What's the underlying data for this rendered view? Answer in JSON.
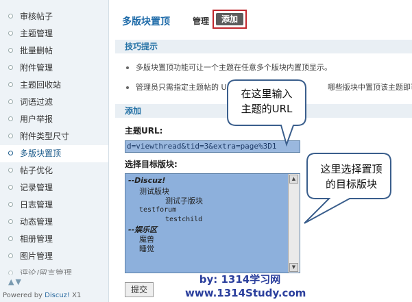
{
  "sidebar": {
    "items": [
      {
        "label": "审核帖子",
        "active": false
      },
      {
        "label": "主题管理",
        "active": false
      },
      {
        "label": "批量删帖",
        "active": false
      },
      {
        "label": "附件管理",
        "active": false
      },
      {
        "label": "主题回收站",
        "active": false
      },
      {
        "label": "词语过滤",
        "active": false
      },
      {
        "label": "用户举报",
        "active": false
      },
      {
        "label": "附件类型尺寸",
        "active": false
      },
      {
        "label": "多版块置顶",
        "active": true
      },
      {
        "label": "帖子优化",
        "active": false
      },
      {
        "label": "记录管理",
        "active": false
      },
      {
        "label": "日志管理",
        "active": false
      },
      {
        "label": "动态管理",
        "active": false
      },
      {
        "label": "相册管理",
        "active": false
      },
      {
        "label": "图片管理",
        "active": false
      },
      {
        "label": "评论/留言管理",
        "active": false
      }
    ],
    "powered_prefix": "Powered by ",
    "powered_brand": "Discuz!",
    "powered_version": " X1"
  },
  "header": {
    "title": "多版块置顶",
    "tab_manage": "管理",
    "tab_add": "添加"
  },
  "tips": {
    "heading": "技巧提示",
    "items": [
      "多版块置顶功能可让一个主题在任意多个版块内置顶显示。",
      "管理员只需指定主题帖的 U",
      "哪些版块中置顶该主题即可"
    ]
  },
  "form": {
    "heading": "添加",
    "url_label": "主题URL:",
    "url_value": "d=viewthread&tid=3&extra=page%3D1",
    "forum_label": "选择目标版块:",
    "options": [
      {
        "text": "--Discuz!",
        "type": "group"
      },
      {
        "text": "测试版块",
        "type": "option"
      },
      {
        "text": "测试子版块",
        "type": "option"
      },
      {
        "text": "testforum",
        "type": "option"
      },
      {
        "text": "testchild",
        "type": "option"
      },
      {
        "text": "--娱乐区",
        "type": "group"
      },
      {
        "text": "魔兽",
        "type": "option"
      },
      {
        "text": "睡觉",
        "type": "option"
      }
    ],
    "submit_label": "提交"
  },
  "callouts": {
    "url_note_line1": "在这里输入",
    "url_note_line2": "主题的URL",
    "forum_note_line1": "这里选择置顶",
    "forum_note_line2": "的目标版块"
  },
  "watermark": {
    "line1": "by: 1314学习网",
    "line2": "www.1314Study.com"
  },
  "colors": {
    "accent": "#1d6aa8",
    "highlight_border": "#c0262c",
    "select_bg": "#8db0dc"
  }
}
